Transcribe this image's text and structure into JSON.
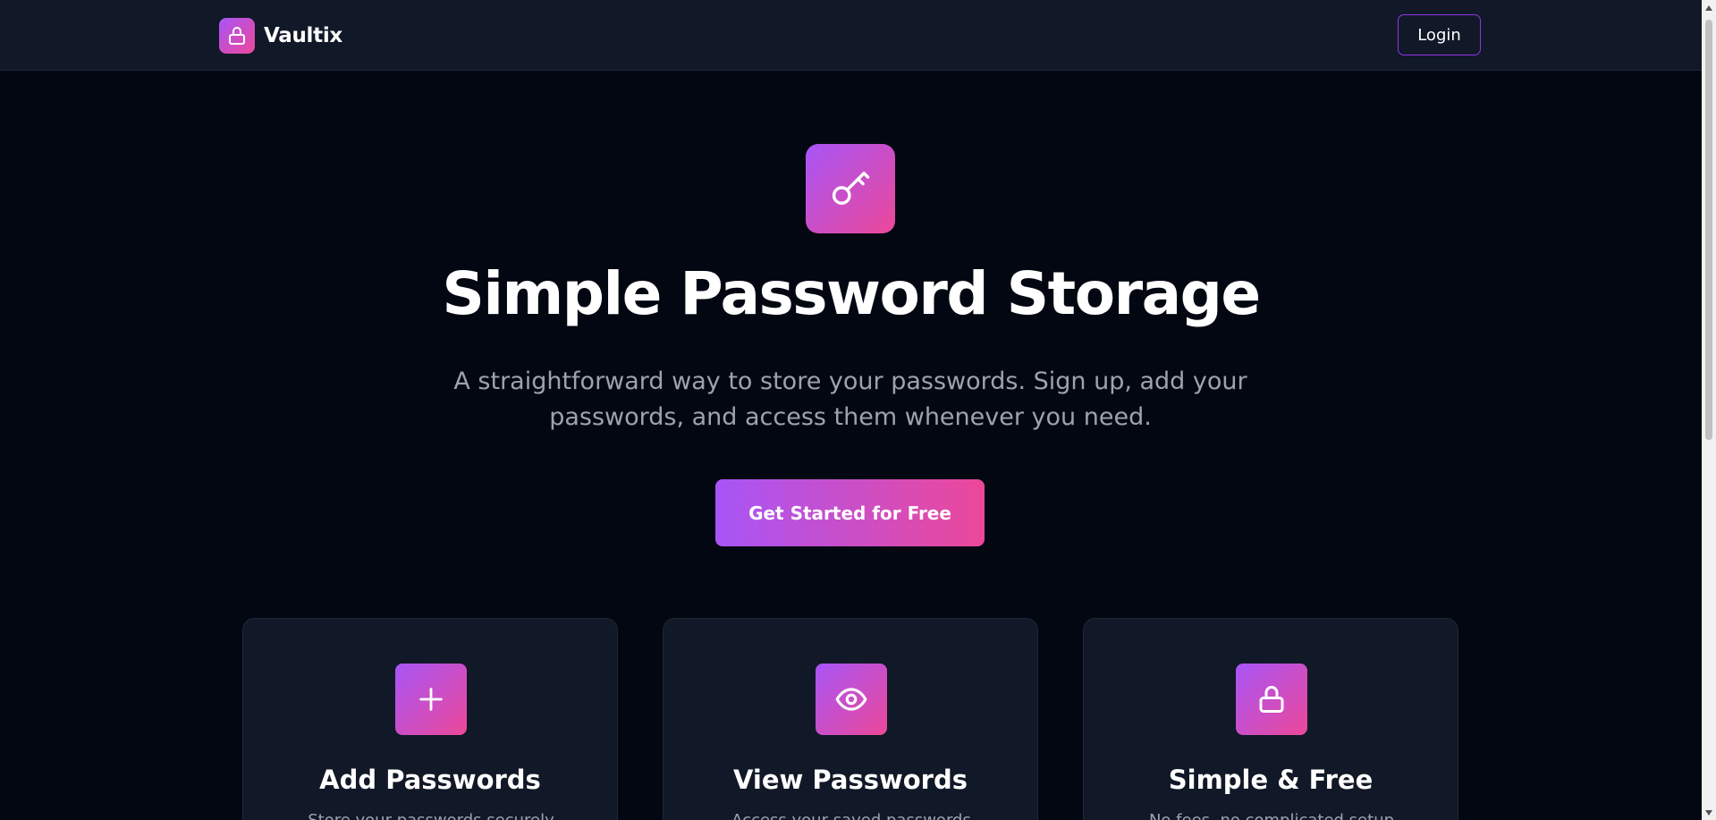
{
  "header": {
    "brand_name": "Vaultix",
    "brand_icon": "lock-icon",
    "login_label": "Login"
  },
  "hero": {
    "icon": "key-icon",
    "title": "Simple Password Storage",
    "subtitle": "A straightforward way to store your passwords. Sign up, add your passwords, and access them whenever you need.",
    "cta_label": "Get Started for Free"
  },
  "features": [
    {
      "icon": "plus-icon",
      "title": "Add Passwords",
      "description": "Store your passwords securely"
    },
    {
      "icon": "eye-icon",
      "title": "View Passwords",
      "description": "Access your saved passwords"
    },
    {
      "icon": "lock-icon",
      "title": "Simple & Free",
      "description": "No fees, no complicated setup"
    }
  ],
  "colors": {
    "background": "#030712",
    "header_bg": "#111827",
    "card_bg": "#111827",
    "accent_start": "#a855f7",
    "accent_end": "#ec4899",
    "muted_text": "#9ca3af"
  }
}
